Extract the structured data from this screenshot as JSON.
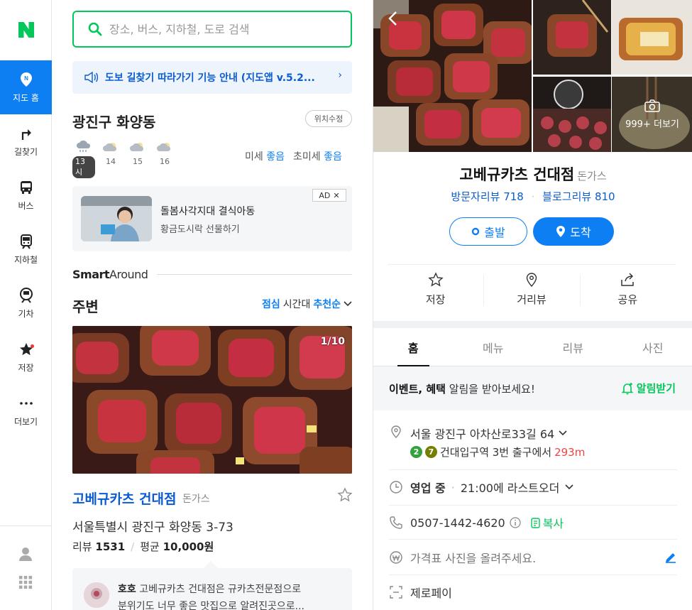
{
  "nav": {
    "items": [
      {
        "label": "지도 홈",
        "icon": "map-pin-icon"
      },
      {
        "label": "길찾기",
        "icon": "directions-icon"
      },
      {
        "label": "버스",
        "icon": "bus-icon"
      },
      {
        "label": "지하철",
        "icon": "subway-icon"
      },
      {
        "label": "기차",
        "icon": "train-icon"
      },
      {
        "label": "저장",
        "icon": "star-icon"
      },
      {
        "label": "더보기",
        "icon": "more-dots-icon"
      }
    ]
  },
  "search": {
    "placeholder": "장소, 버스, 지하철, 도로 검색"
  },
  "notice": {
    "text": "도보 길찾기 따라가기 기능 안내 (지도앱 v.5.2..."
  },
  "location": {
    "title": "광진구 화양동",
    "edit_label": "위치수정"
  },
  "weather": {
    "hours": [
      {
        "time": "13시",
        "current": true
      },
      {
        "time": "14"
      },
      {
        "time": "15"
      },
      {
        "time": "16"
      }
    ],
    "dust_label": "미세",
    "dust_value": "좋음",
    "ultra_label": "초미세",
    "ultra_value": "좋음"
  },
  "ad": {
    "title": "돌봄사각지대 결식아동",
    "subtitle": "황금도시락 선물하기",
    "badge": "AD"
  },
  "smart_around": {
    "brand_bold": "Smart",
    "brand_light": "Around"
  },
  "nearby": {
    "title": "주변",
    "sort_time": "점심",
    "sort_mid": "시간대",
    "sort_order": "추천순",
    "photo_counter": "1/10",
    "place": {
      "name": "고베규카츠 건대점",
      "category": "돈가스",
      "address": "서울특별시 광진구 화양동 3-73",
      "review_label": "리뷰",
      "review_count": "1531",
      "avg_label": "평균",
      "avg_price": "10,000원"
    },
    "review": {
      "author": "호호",
      "text1": " 고베규카츠 건대점은 규카츠전문점으로",
      "text2": "분위기도 너무 좋은 맛집으로 알려진곳으로..."
    }
  },
  "detail": {
    "more_label": "999+ 더보기",
    "name": "고베규카츠 건대점",
    "category": "돈가스",
    "visitor_reviews": "방문자리뷰 718",
    "blog_reviews": "블로그리뷰 810",
    "depart_label": "출발",
    "arrive_label": "도착",
    "actions": [
      {
        "label": "저장",
        "icon": "star-outline-icon"
      },
      {
        "label": "거리뷰",
        "icon": "street-view-icon"
      },
      {
        "label": "공유",
        "icon": "share-icon"
      }
    ],
    "tabs": [
      "홈",
      "메뉴",
      "리뷰",
      "사진"
    ],
    "active_tab": "홈",
    "event_bold": "이벤트, 혜택",
    "event_text": " 알림을 받아보세요!",
    "alarm_label": "알림받기",
    "address": "서울 광진구 아차산로33길 64",
    "subway_line_2": "2",
    "subway_line_7": "7",
    "station": "건대입구역 3번 출구에서",
    "distance": "293m",
    "hours_status": "영업 중",
    "hours_text": "21:00에 라스트오더",
    "phone": "0507-1442-4620",
    "copy_label": "복사",
    "price_prompt": "가격표 사진을 올려주세요.",
    "payment": "제로페이"
  },
  "colors": {
    "naver_green": "#03c75a",
    "accent_blue": "#0d7ff2",
    "line2_green": "#33a23d",
    "line7_olive": "#747f00"
  }
}
